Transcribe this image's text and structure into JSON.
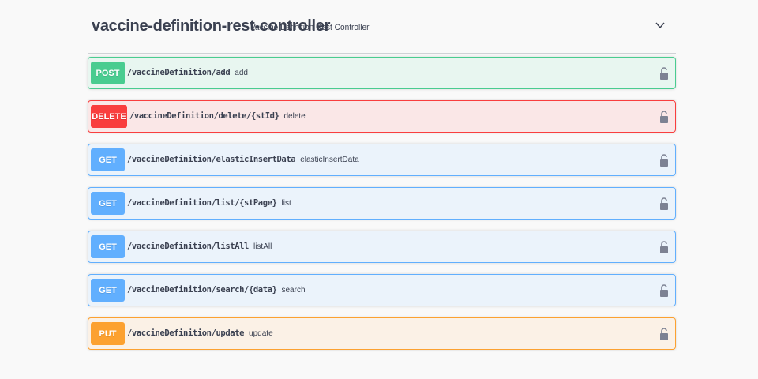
{
  "tag": {
    "title": "vaccine-definition-rest-controller",
    "description": "Vaccine Definition Rest Controller",
    "expand_icon": "chevron-down-icon"
  },
  "colors": {
    "post": "#49cc90",
    "delete": "#f93e3e",
    "get": "#61affe",
    "put": "#fca130"
  },
  "operations": [
    {
      "method": "POST",
      "path": "/vaccineDefinition/add",
      "summary": "add"
    },
    {
      "method": "DELETE",
      "path": "/vaccineDefinition/delete/{stId}",
      "summary": "delete"
    },
    {
      "method": "GET",
      "path": "/vaccineDefinition/elasticInsertData",
      "summary": "elasticInsertData"
    },
    {
      "method": "GET",
      "path": "/vaccineDefinition/list/{stPage}",
      "summary": "list"
    },
    {
      "method": "GET",
      "path": "/vaccineDefinition/listAll",
      "summary": "listAll"
    },
    {
      "method": "GET",
      "path": "/vaccineDefinition/search/{data}",
      "summary": "search"
    },
    {
      "method": "PUT",
      "path": "/vaccineDefinition/update",
      "summary": "update"
    }
  ]
}
